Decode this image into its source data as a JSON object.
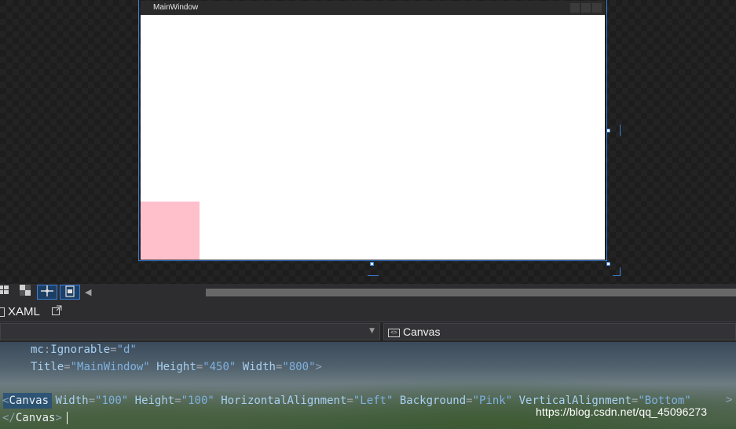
{
  "designer": {
    "window_title": "MainWindow",
    "colors": {
      "selection": "#3c7fd6",
      "canvas_background": "#ffc0cb"
    }
  },
  "toolbar": {
    "buttons": [
      {
        "name": "grid-icon"
      },
      {
        "name": "checker-icon"
      },
      {
        "name": "snap-icon"
      },
      {
        "name": "device-icon"
      }
    ]
  },
  "tabs": {
    "xaml_label": "XAML",
    "popout_icon": "popout-icon"
  },
  "nav": {
    "element_label": "Canvas"
  },
  "code": {
    "line1": {
      "attr": "mc",
      "sep": ":",
      "attr2": "Ignorable",
      "eq": "=",
      "val": "\"d\""
    },
    "line2": {
      "a1": "Title",
      "v1": "\"MainWindow\"",
      "a2": "Height",
      "v2": "\"450\"",
      "a3": "Width",
      "v3": "\"800\"",
      "close": ">"
    },
    "line4": {
      "open": "<",
      "tag": "Canvas",
      "a1": "Width",
      "v1": "\"100\"",
      "a2": "Height",
      "v2": "\"100\"",
      "a3": "HorizontalAlignment",
      "v3": "\"Left\"",
      "a4": "Background",
      "v4": "\"Pink\"",
      "a5": "VerticalAlignment",
      "v5": "\"Bottom\"",
      "close": ">"
    },
    "line5": {
      "open": "</",
      "tag": "Canvas",
      "close": ">"
    }
  },
  "watermark": "https://blog.csdn.net/qq_45096273"
}
